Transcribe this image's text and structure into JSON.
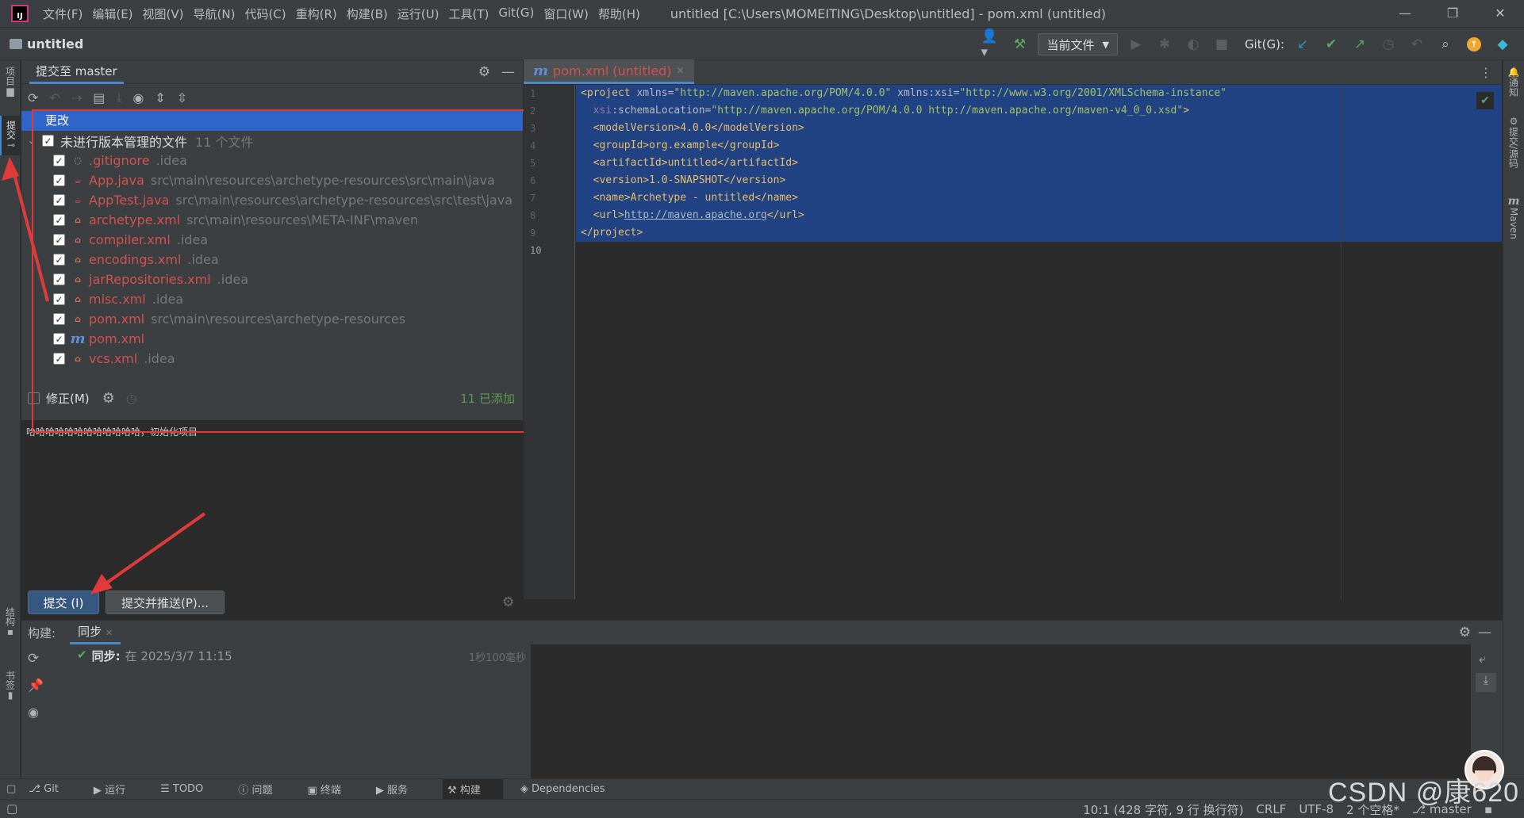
{
  "titlebar": {
    "menu": [
      "文件(F)",
      "编辑(E)",
      "视图(V)",
      "导航(N)",
      "代码(C)",
      "重构(R)",
      "构建(B)",
      "运行(U)",
      "工具(T)",
      "Git(G)",
      "窗口(W)",
      "帮助(H)"
    ],
    "window_title": "untitled [C:\\Users\\MOMEITING\\Desktop\\untitled] - pom.xml (untitled)"
  },
  "navbar": {
    "project": "untitled",
    "run_config": "当前文件",
    "git_label": "Git(G):"
  },
  "left_stripe": {
    "project": "项目",
    "commit": "提交",
    "structure": "结构",
    "bookmarks": "书签"
  },
  "right_stripe": {
    "notifications": "通知",
    "vcs": "提交/源码",
    "maven": "Maven"
  },
  "commit_panel": {
    "title": "提交至 master",
    "changes_header": "更改",
    "group_label": "未进行版本管理的文件",
    "group_count": "11 个文件",
    "files": [
      {
        "name": ".gitignore",
        "path": ".idea",
        "icon": "gitignore-icon"
      },
      {
        "name": "App.java",
        "path": "src\\main\\resources\\archetype-resources\\src\\main\\java",
        "icon": "java-file-icon"
      },
      {
        "name": "AppTest.java",
        "path": "src\\main\\resources\\archetype-resources\\src\\test\\java",
        "icon": "java-file-icon"
      },
      {
        "name": "archetype.xml",
        "path": "src\\main\\resources\\META-INF\\maven",
        "icon": "xml-file-icon"
      },
      {
        "name": "compiler.xml",
        "path": ".idea",
        "icon": "xml-file-icon"
      },
      {
        "name": "encodings.xml",
        "path": ".idea",
        "icon": "xml-file-icon"
      },
      {
        "name": "jarRepositories.xml",
        "path": ".idea",
        "icon": "xml-file-icon"
      },
      {
        "name": "misc.xml",
        "path": ".idea",
        "icon": "xml-file-icon"
      },
      {
        "name": "pom.xml",
        "path": "src\\main\\resources\\archetype-resources",
        "icon": "xml-file-icon"
      },
      {
        "name": "pom.xml",
        "path": "",
        "icon": "maven-file-icon"
      },
      {
        "name": "vcs.xml",
        "path": ".idea",
        "icon": "xml-file-icon"
      }
    ],
    "amend_label": "修正(M)",
    "added_status": "11 已添加",
    "commit_message": "哈哈哈哈哈哈哈哈哈哈哈哈，初始化项目",
    "commit_button": "提交 (I)",
    "commit_push_button": "提交并推送(P)..."
  },
  "editor": {
    "tab_label": "pom.xml (untitled)",
    "line_numbers": [
      "1",
      "2",
      "3",
      "4",
      "5",
      "6",
      "7",
      "8",
      "9",
      "10"
    ],
    "code": {
      "l1_a": "<project ",
      "l1_b": "xmlns=",
      "l1_c": "\"http://maven.apache.org/POM/4.0.0\"",
      "l1_d": " xmlns:xsi=",
      "l1_e": "\"http://www.w3.org/2001/XMLSchema-instance\"",
      "l2_a": "xsi",
      "l2_b": ":schemaLocation=",
      "l2_c": "\"http://maven.apache.org/POM/4.0.0 http://maven.apache.org/maven-v4_0_0.xsd\"",
      "l2_d": ">",
      "l3": "<modelVersion>4.0.0</modelVersion>",
      "l4": "<groupId>org.example</groupId>",
      "l5": "<artifactId>untitled</artifactId>",
      "l6": "<version>1.0-SNAPSHOT</version>",
      "l7": "<name>Archetype - untitled</name>",
      "l8_a": "<url>",
      "l8_b": "http://maven.apache.org",
      "l8_c": "</url>",
      "l9": "</project>"
    }
  },
  "build_panel": {
    "label": "构建:",
    "tab": "同步",
    "entry_bold": "同步:",
    "entry_time": "在 2025/3/7 11:15",
    "duration": "1秒100毫秒"
  },
  "bottom_tabs": [
    "Git",
    "运行",
    "TODO",
    "问题",
    "终端",
    "服务",
    "构建",
    "Dependencies"
  ],
  "status": {
    "position": "10:1 (428 字符, 9 行 换行符)",
    "line_sep": "CRLF",
    "encoding": "UTF-8",
    "indent": "2 个空格*",
    "branch": "master"
  },
  "watermark": "CSDN @康620",
  "colors": {
    "accent": "#4a88c7",
    "selection": "#214283",
    "changes_header": "#2f65ca",
    "annotation_red": "#e03a3a",
    "unversioned": "#d25252",
    "added": "#629755"
  }
}
